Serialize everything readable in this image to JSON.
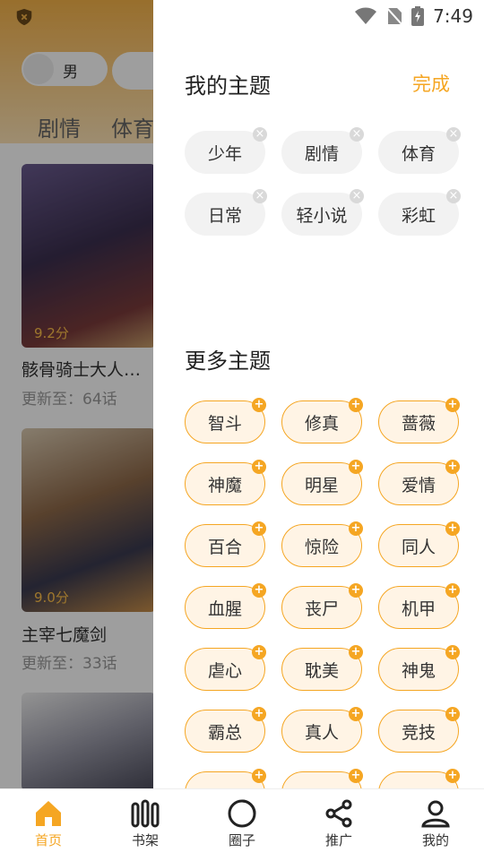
{
  "status": {
    "time": "7:49"
  },
  "background": {
    "gender_toggle": "男",
    "categories": [
      "剧情",
      "体育"
    ],
    "comics": [
      {
        "title": "骸骨骑士大人…",
        "update": "更新至：64话",
        "score": "9.2分"
      },
      {
        "title": "主宰七魔剑",
        "update": "更新至：33话",
        "score": "9.0分"
      },
      {
        "title": "",
        "update": "",
        "score": ""
      }
    ]
  },
  "drawer": {
    "my_title": "我的主题",
    "done_label": "完成",
    "my_topics": [
      "少年",
      "剧情",
      "体育",
      "日常",
      "轻小说",
      "彩虹"
    ],
    "more_title": "更多主题",
    "more_topics": [
      "智斗",
      "修真",
      "蔷薇",
      "神魔",
      "明星",
      "爱情",
      "百合",
      "惊险",
      "同人",
      "血腥",
      "丧尸",
      "机甲",
      "虐心",
      "耽美",
      "神鬼",
      "霸总",
      "真人",
      "竞技",
      "",
      "",
      ""
    ]
  },
  "nav": [
    {
      "label": "首页",
      "icon": "home-icon",
      "active": true
    },
    {
      "label": "书架",
      "icon": "bookshelf-icon",
      "active": false
    },
    {
      "label": "圈子",
      "icon": "circle-icon",
      "active": false
    },
    {
      "label": "推广",
      "icon": "share-icon",
      "active": false
    },
    {
      "label": "我的",
      "icon": "user-icon",
      "active": false
    }
  ],
  "colors": {
    "accent": "#f5a623",
    "chip_bg": "#f2f2f2",
    "more_chip_bg": "#fff4e5"
  }
}
